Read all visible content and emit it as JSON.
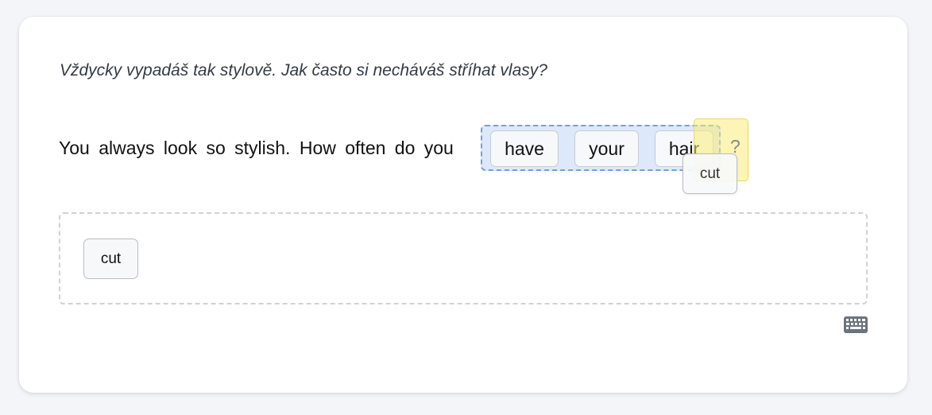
{
  "exercise": {
    "prompt": "Vždycky vypadáš tak stylově. Jak často si necháváš stříhat vlasy?",
    "sentence_prefix": "You always look so stylish. How often do you",
    "placed_words": [
      "have",
      "your",
      "hair"
    ],
    "punctuation": "?",
    "dragging_word": "cut",
    "word_bank": [
      "cut"
    ]
  },
  "controls": {
    "keyboard_icon": "keyboard-icon"
  },
  "colors": {
    "drop_zone_border": "#6ea0ea",
    "drop_zone_fill": "#dde8fb",
    "highlight": "#faec78",
    "keyboard_icon": "#6b7280"
  }
}
